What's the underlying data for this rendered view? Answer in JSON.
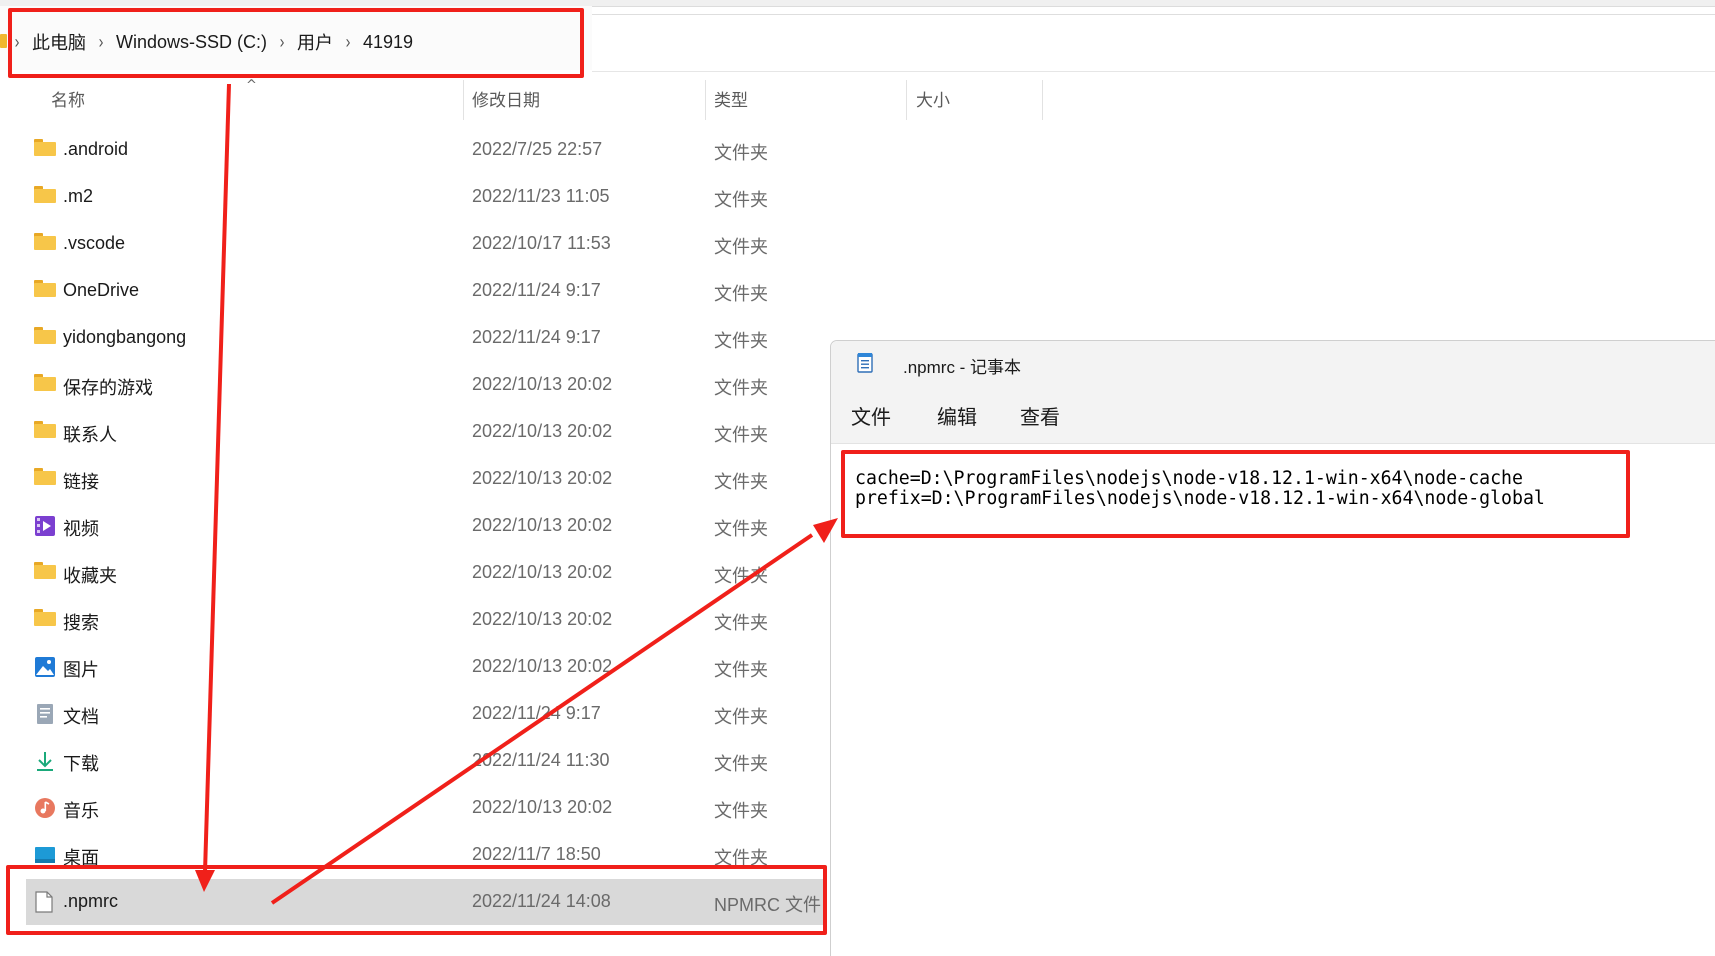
{
  "explorer": {
    "breadcrumb": [
      "此电脑",
      "Windows-SSD (C:)",
      "用户",
      "41919"
    ],
    "columns": {
      "name": "名称",
      "date": "修改日期",
      "type": "类型",
      "size": "大小"
    },
    "rows": [
      {
        "name": ".android",
        "date": "2022/7/25 22:57",
        "type": "文件夹",
        "icon": "folder-icon"
      },
      {
        "name": ".m2",
        "date": "2022/11/23 11:05",
        "type": "文件夹",
        "icon": "folder-icon"
      },
      {
        "name": ".vscode",
        "date": "2022/10/17 11:53",
        "type": "文件夹",
        "icon": "folder-icon"
      },
      {
        "name": "OneDrive",
        "date": "2022/11/24 9:17",
        "type": "文件夹",
        "icon": "folder-icon"
      },
      {
        "name": "yidongbangong",
        "date": "2022/11/24 9:17",
        "type": "文件夹",
        "icon": "folder-icon"
      },
      {
        "name": "保存的游戏",
        "date": "2022/10/13 20:02",
        "type": "文件夹",
        "icon": "folder-icon"
      },
      {
        "name": "联系人",
        "date": "2022/10/13 20:02",
        "type": "文件夹",
        "icon": "folder-icon"
      },
      {
        "name": "链接",
        "date": "2022/10/13 20:02",
        "type": "文件夹",
        "icon": "folder-icon"
      },
      {
        "name": "视频",
        "date": "2022/10/13 20:02",
        "type": "文件夹",
        "icon": "video-folder-icon"
      },
      {
        "name": "收藏夹",
        "date": "2022/10/13 20:02",
        "type": "文件夹",
        "icon": "folder-icon"
      },
      {
        "name": "搜索",
        "date": "2022/10/13 20:02",
        "type": "文件夹",
        "icon": "folder-icon"
      },
      {
        "name": "图片",
        "date": "2022/10/13 20:02",
        "type": "文件夹",
        "icon": "pictures-folder-icon"
      },
      {
        "name": "文档",
        "date": "2022/11/24 9:17",
        "type": "文件夹",
        "icon": "documents-folder-icon"
      },
      {
        "name": "下载",
        "date": "2022/11/24 11:30",
        "type": "文件夹",
        "icon": "download-folder-icon"
      },
      {
        "name": "音乐",
        "date": "2022/10/13 20:02",
        "type": "文件夹",
        "icon": "music-folder-icon"
      },
      {
        "name": "桌面",
        "date": "2022/11/7 18:50",
        "type": "文件夹",
        "icon": "desktop-folder-icon"
      },
      {
        "name": ".npmrc",
        "date": "2022/11/24 14:08",
        "type": "NPMRC 文件",
        "icon": "file-icon"
      }
    ]
  },
  "notepad": {
    "title": ".npmrc - 记事本",
    "menu": {
      "file": "文件",
      "edit": "编辑",
      "view": "查看"
    },
    "lines": [
      "cache=D:\\ProgramFiles\\nodejs\\node-v18.12.1-win-x64\\node-cache",
      "prefix=D:\\ProgramFiles\\nodejs\\node-v18.12.1-win-x64\\node-global"
    ]
  },
  "colors": {
    "annotation_red": "#f0201a",
    "folder_yellow": "#f7c649",
    "selected_row": "#d9d9d9"
  }
}
